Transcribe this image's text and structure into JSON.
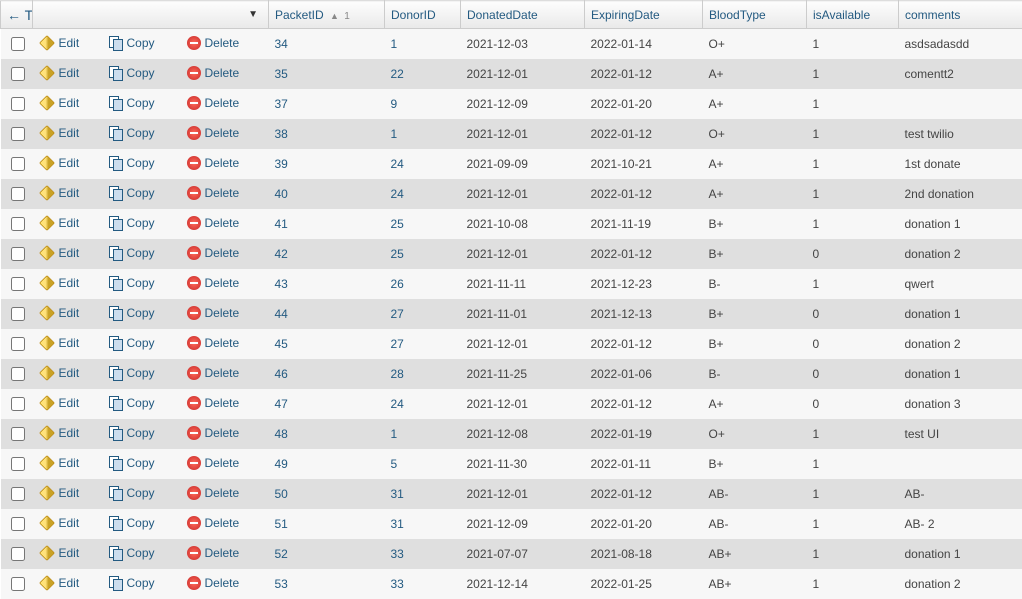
{
  "header": {
    "tools_label": "←T→",
    "dropdown_label": "▼",
    "columns": [
      {
        "key": "PacketID",
        "label": "PacketID",
        "sorted": true,
        "sort_index": "1"
      },
      {
        "key": "DonorID",
        "label": "DonorID"
      },
      {
        "key": "DonatedDate",
        "label": "DonatedDate"
      },
      {
        "key": "ExpiringDate",
        "label": "ExpiringDate"
      },
      {
        "key": "BloodType",
        "label": "BloodType"
      },
      {
        "key": "isAvailable",
        "label": "isAvailable"
      },
      {
        "key": "comments",
        "label": "comments"
      }
    ],
    "actions": {
      "edit": "Edit",
      "copy": "Copy",
      "delete": "Delete"
    }
  },
  "rows": [
    {
      "PacketID": "34",
      "DonorID": "1",
      "DonatedDate": "2021-12-03",
      "ExpiringDate": "2022-01-14",
      "BloodType": "O+",
      "isAvailable": "1",
      "comments": "asdsadasdd"
    },
    {
      "PacketID": "35",
      "DonorID": "22",
      "DonatedDate": "2021-12-01",
      "ExpiringDate": "2022-01-12",
      "BloodType": "A+",
      "isAvailable": "1",
      "comments": "comentt2"
    },
    {
      "PacketID": "37",
      "DonorID": "9",
      "DonatedDate": "2021-12-09",
      "ExpiringDate": "2022-01-20",
      "BloodType": "A+",
      "isAvailable": "1",
      "comments": ""
    },
    {
      "PacketID": "38",
      "DonorID": "1",
      "DonatedDate": "2021-12-01",
      "ExpiringDate": "2022-01-12",
      "BloodType": "O+",
      "isAvailable": "1",
      "comments": "test twilio"
    },
    {
      "PacketID": "39",
      "DonorID": "24",
      "DonatedDate": "2021-09-09",
      "ExpiringDate": "2021-10-21",
      "BloodType": "A+",
      "isAvailable": "1",
      "comments": "1st donate"
    },
    {
      "PacketID": "40",
      "DonorID": "24",
      "DonatedDate": "2021-12-01",
      "ExpiringDate": "2022-01-12",
      "BloodType": "A+",
      "isAvailable": "1",
      "comments": "2nd donation"
    },
    {
      "PacketID": "41",
      "DonorID": "25",
      "DonatedDate": "2021-10-08",
      "ExpiringDate": "2021-11-19",
      "BloodType": "B+",
      "isAvailable": "1",
      "comments": "donation 1"
    },
    {
      "PacketID": "42",
      "DonorID": "25",
      "DonatedDate": "2021-12-01",
      "ExpiringDate": "2022-01-12",
      "BloodType": "B+",
      "isAvailable": "0",
      "comments": "donation 2"
    },
    {
      "PacketID": "43",
      "DonorID": "26",
      "DonatedDate": "2021-11-11",
      "ExpiringDate": "2021-12-23",
      "BloodType": "B-",
      "isAvailable": "1",
      "comments": "qwert"
    },
    {
      "PacketID": "44",
      "DonorID": "27",
      "DonatedDate": "2021-11-01",
      "ExpiringDate": "2021-12-13",
      "BloodType": "B+",
      "isAvailable": "0",
      "comments": "donation 1"
    },
    {
      "PacketID": "45",
      "DonorID": "27",
      "DonatedDate": "2021-12-01",
      "ExpiringDate": "2022-01-12",
      "BloodType": "B+",
      "isAvailable": "0",
      "comments": "donation 2"
    },
    {
      "PacketID": "46",
      "DonorID": "28",
      "DonatedDate": "2021-11-25",
      "ExpiringDate": "2022-01-06",
      "BloodType": "B-",
      "isAvailable": "0",
      "comments": "donation 1"
    },
    {
      "PacketID": "47",
      "DonorID": "24",
      "DonatedDate": "2021-12-01",
      "ExpiringDate": "2022-01-12",
      "BloodType": "A+",
      "isAvailable": "0",
      "comments": "donation 3"
    },
    {
      "PacketID": "48",
      "DonorID": "1",
      "DonatedDate": "2021-12-08",
      "ExpiringDate": "2022-01-19",
      "BloodType": "O+",
      "isAvailable": "1",
      "comments": "test UI"
    },
    {
      "PacketID": "49",
      "DonorID": "5",
      "DonatedDate": "2021-11-30",
      "ExpiringDate": "2022-01-11",
      "BloodType": "B+",
      "isAvailable": "1",
      "comments": ""
    },
    {
      "PacketID": "50",
      "DonorID": "31",
      "DonatedDate": "2021-12-01",
      "ExpiringDate": "2022-01-12",
      "BloodType": "AB-",
      "isAvailable": "1",
      "comments": "AB-"
    },
    {
      "PacketID": "51",
      "DonorID": "31",
      "DonatedDate": "2021-12-09",
      "ExpiringDate": "2022-01-20",
      "BloodType": "AB-",
      "isAvailable": "1",
      "comments": "AB- 2"
    },
    {
      "PacketID": "52",
      "DonorID": "33",
      "DonatedDate": "2021-07-07",
      "ExpiringDate": "2021-08-18",
      "BloodType": "AB+",
      "isAvailable": "1",
      "comments": "donation 1"
    },
    {
      "PacketID": "53",
      "DonorID": "33",
      "DonatedDate": "2021-12-14",
      "ExpiringDate": "2022-01-25",
      "BloodType": "AB+",
      "isAvailable": "1",
      "comments": "donation 2"
    }
  ]
}
